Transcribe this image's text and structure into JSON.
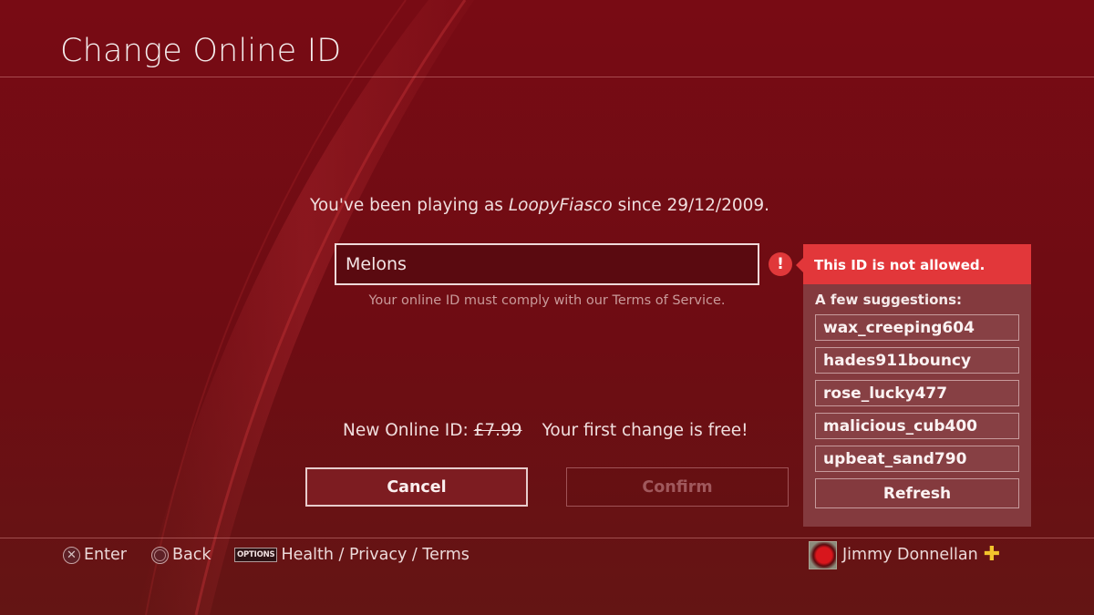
{
  "page": {
    "title": "Change Online ID"
  },
  "intro": {
    "prefix": "You've been playing as ",
    "current_id": "LoopyFiasco",
    "suffix": " since 29/12/2009."
  },
  "id_input": {
    "value": "Melons",
    "hint": "Your online ID must comply with our Terms of Service."
  },
  "error": {
    "icon": "exclamation-icon",
    "message": "This ID is not allowed.",
    "suggestions_label": "A few suggestions:",
    "suggestions": [
      "wax_creeping604",
      "hades911bouncy",
      "rose_lucky477",
      "malicious_cub400",
      "upbeat_sand790"
    ],
    "refresh_label": "Refresh"
  },
  "pricing": {
    "label": "New Online ID: ",
    "old_price": "£7.99",
    "note": "Your first change is free!"
  },
  "actions": {
    "cancel_label": "Cancel",
    "confirm_label": "Confirm",
    "confirm_enabled": false
  },
  "footer": {
    "enter": {
      "icon": "cross-button-icon",
      "glyph": "✕",
      "label": "Enter"
    },
    "back": {
      "icon": "circle-button-icon",
      "label": "Back"
    },
    "options": {
      "badge": "OPTIONS",
      "label": "Health / Privacy / Terms"
    },
    "user": {
      "name": "Jimmy Donnellan",
      "plus_icon": "✚"
    }
  },
  "colors": {
    "background": "#740c13",
    "error_red": "#e2373a",
    "popup_body": "#843a3e",
    "plus_gold": "#f2c42c"
  }
}
